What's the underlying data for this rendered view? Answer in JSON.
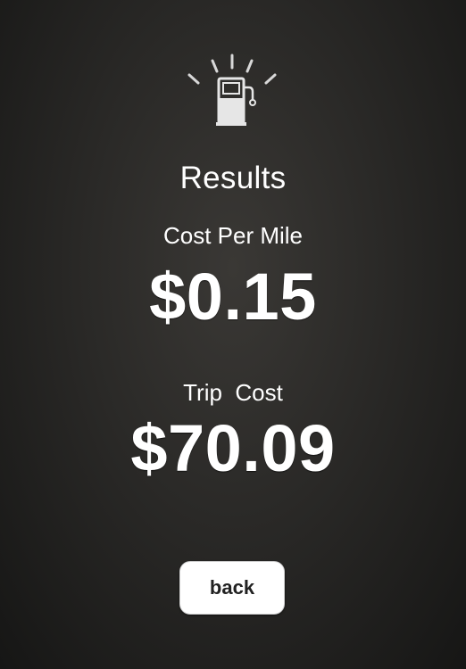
{
  "header": {
    "icon": "gas-pump-icon",
    "title": "Results"
  },
  "cost_per_mile": {
    "label": "Cost Per Mile",
    "value": "$0.15"
  },
  "trip_cost": {
    "label": "Trip  Cost",
    "value": "$70.09"
  },
  "actions": {
    "back_label": "back"
  },
  "colors": {
    "text": "#ffffff",
    "background": "#2a2927",
    "button_bg": "#ffffff",
    "button_text": "#222222"
  }
}
